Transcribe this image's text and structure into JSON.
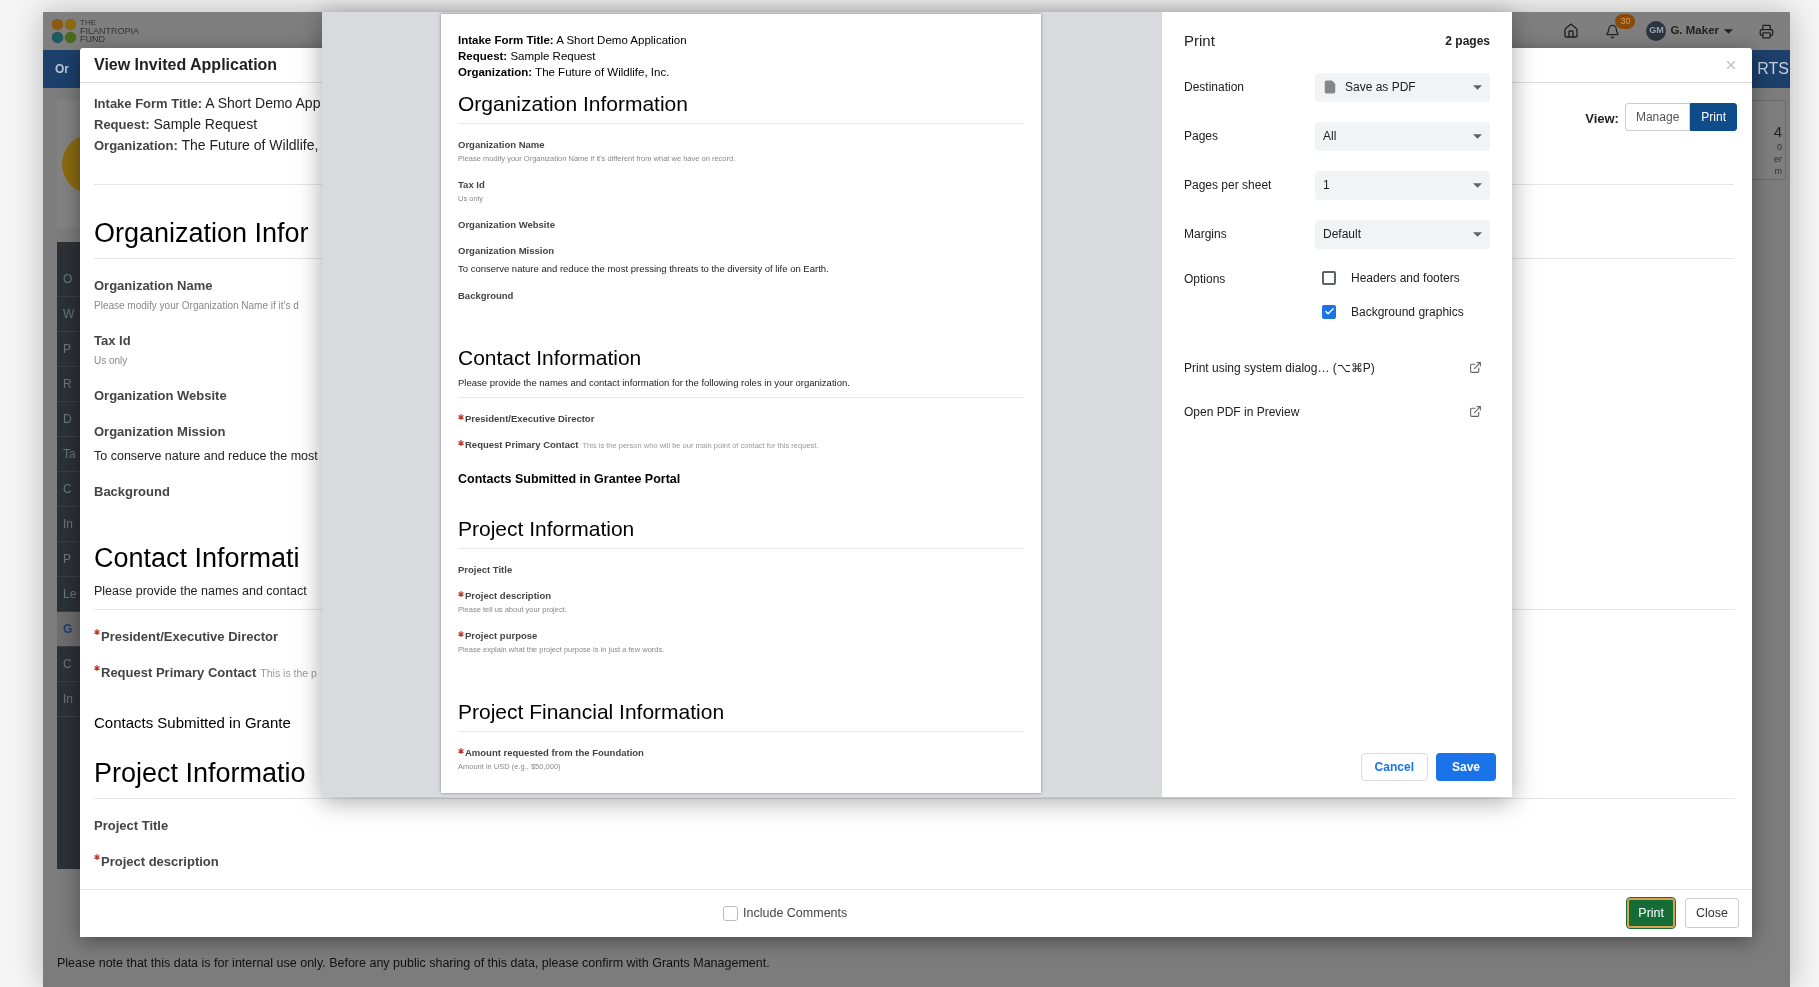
{
  "app": {
    "logo_text": [
      "THE",
      "FILANTROPIA",
      "FUND"
    ],
    "nav_left": "Or",
    "nav_right": "RTS",
    "notifications": "30",
    "user_initials": "GM",
    "user_name": "G. Maker",
    "sidebar_items": [
      {
        "label": "O",
        "selected": false
      },
      {
        "label": "W",
        "selected": false
      },
      {
        "label": "P",
        "selected": false
      },
      {
        "label": "R",
        "selected": false
      },
      {
        "label": "D",
        "selected": false
      },
      {
        "label": "Ta",
        "selected": false
      },
      {
        "label": "C",
        "selected": false
      },
      {
        "label": "In",
        "selected": false
      },
      {
        "label": "P",
        "selected": false
      },
      {
        "label": "Le",
        "selected": false
      },
      {
        "label": "G",
        "selected": true
      },
      {
        "label": "C",
        "selected": false
      },
      {
        "label": "In",
        "selected": false
      }
    ],
    "right_fragments": [
      "4",
      "0",
      "er",
      "m"
    ],
    "footer_note": "Please note that this data is for internal use only. Before any public sharing of this data, please confirm with Grants Management."
  },
  "modal": {
    "title": "View Invited Application",
    "meta": [
      "**Intake Form Title:** A Short Demo App",
      "**Request:** Sample Request",
      "**Organization:** The Future of Wildlife,"
    ],
    "view_label": "View:",
    "view_options": [
      {
        "label": "Manage",
        "selected": false
      },
      {
        "label": "Print",
        "selected": true
      }
    ],
    "content": [
      {
        "kind": "heading",
        "text": "Organization Infor"
      },
      {
        "kind": "divider"
      },
      {
        "kind": "field",
        "label": "Organization Name",
        "required": false,
        "hint": "Please modify your Organization Name if it's d"
      },
      {
        "kind": "field",
        "label": "Tax Id",
        "required": false,
        "hint": "Us only"
      },
      {
        "kind": "field",
        "label": "Organization Website",
        "required": false
      },
      {
        "kind": "field",
        "label": "Organization Mission",
        "required": false,
        "value": "To conserve nature and reduce the most"
      },
      {
        "kind": "field",
        "label": "Background",
        "required": false
      },
      {
        "kind": "heading",
        "text": "Contact Informati"
      },
      {
        "kind": "description",
        "text": "Please provide the names and contact"
      },
      {
        "kind": "divider"
      },
      {
        "kind": "field",
        "label": "President/Executive Director",
        "required": true
      },
      {
        "kind": "field",
        "label": "Request Primary Contact",
        "required": true,
        "note": "This is the p"
      },
      {
        "kind": "subheading",
        "text": "Contacts Submitted in Grante"
      },
      {
        "kind": "heading",
        "text": "Project Informatio"
      },
      {
        "kind": "divider"
      },
      {
        "kind": "field",
        "label": "Project Title",
        "required": false
      },
      {
        "kind": "field",
        "label": "Project description",
        "required": true
      }
    ],
    "include_comments": {
      "label": "Include Comments",
      "checked": false
    },
    "buttons": [
      {
        "label": "Print",
        "kind": "primary"
      },
      {
        "label": "Close",
        "kind": "default"
      }
    ]
  },
  "print_preview": {
    "meta": [
      "**Intake Form Title:** A Short Demo Application",
      "**Request:** Sample Request",
      "**Organization:** The Future of Wildlife, Inc."
    ],
    "content": [
      {
        "kind": "heading",
        "text": "Organization Information"
      },
      {
        "kind": "divider"
      },
      {
        "kind": "field",
        "label": "Organization Name",
        "required": false,
        "hint": "Please modify your Organization Name if it's different from what we have on record."
      },
      {
        "kind": "field",
        "label": "Tax Id",
        "required": false,
        "hint": "Us only"
      },
      {
        "kind": "field",
        "label": "Organization Website",
        "required": false
      },
      {
        "kind": "field",
        "label": "Organization Mission",
        "required": false,
        "value": "To conserve nature and reduce the most pressing threats to the diversity of life on Earth."
      },
      {
        "kind": "field",
        "label": "Background",
        "required": false
      },
      {
        "kind": "heading",
        "text": "Contact Information"
      },
      {
        "kind": "description",
        "text": "Please provide the names and contact information for the following roles in your organization."
      },
      {
        "kind": "divider"
      },
      {
        "kind": "field",
        "label": "President/Executive Director",
        "required": true
      },
      {
        "kind": "field",
        "label": "Request Primary Contact",
        "required": true,
        "note": "This is the person who will be our main point of contact for this request."
      },
      {
        "kind": "subheading",
        "text": "Contacts Submitted in Grantee Portal"
      },
      {
        "kind": "heading",
        "text": "Project Information"
      },
      {
        "kind": "divider"
      },
      {
        "kind": "field",
        "label": "Project Title",
        "required": false
      },
      {
        "kind": "field",
        "label": "Project description",
        "required": true,
        "hint": "Please tell us about your project."
      },
      {
        "kind": "field",
        "label": "Project purpose",
        "required": true,
        "hint": "Please explain what the project purpose is in just a few words."
      },
      {
        "kind": "heading",
        "text": "Project Financial Information"
      },
      {
        "kind": "divider"
      },
      {
        "kind": "field",
        "label": "Amount requested from the Foundation",
        "required": true,
        "hint": "Amount in USD (e.g., $50,000)"
      }
    ]
  },
  "print_panel": {
    "title": "Print",
    "page_count": "2 pages",
    "settings": [
      {
        "label": "Destination",
        "value": "Save as PDF",
        "kind": "document"
      },
      {
        "label": "Pages",
        "value": "All",
        "kind": "plain"
      },
      {
        "label": "Pages per sheet",
        "value": "1",
        "kind": "plain"
      },
      {
        "label": "Margins",
        "value": "Default",
        "kind": "plain"
      }
    ],
    "options_label": "Options",
    "options": [
      {
        "label": "Headers and footers",
        "checked": false
      },
      {
        "label": "Background graphics",
        "checked": true
      }
    ],
    "links": [
      "Print using system dialog… (⌥⌘P)",
      "Open PDF in Preview"
    ],
    "buttons": [
      {
        "label": "Cancel",
        "kind": "secondary"
      },
      {
        "label": "Save",
        "kind": "primary"
      }
    ]
  }
}
